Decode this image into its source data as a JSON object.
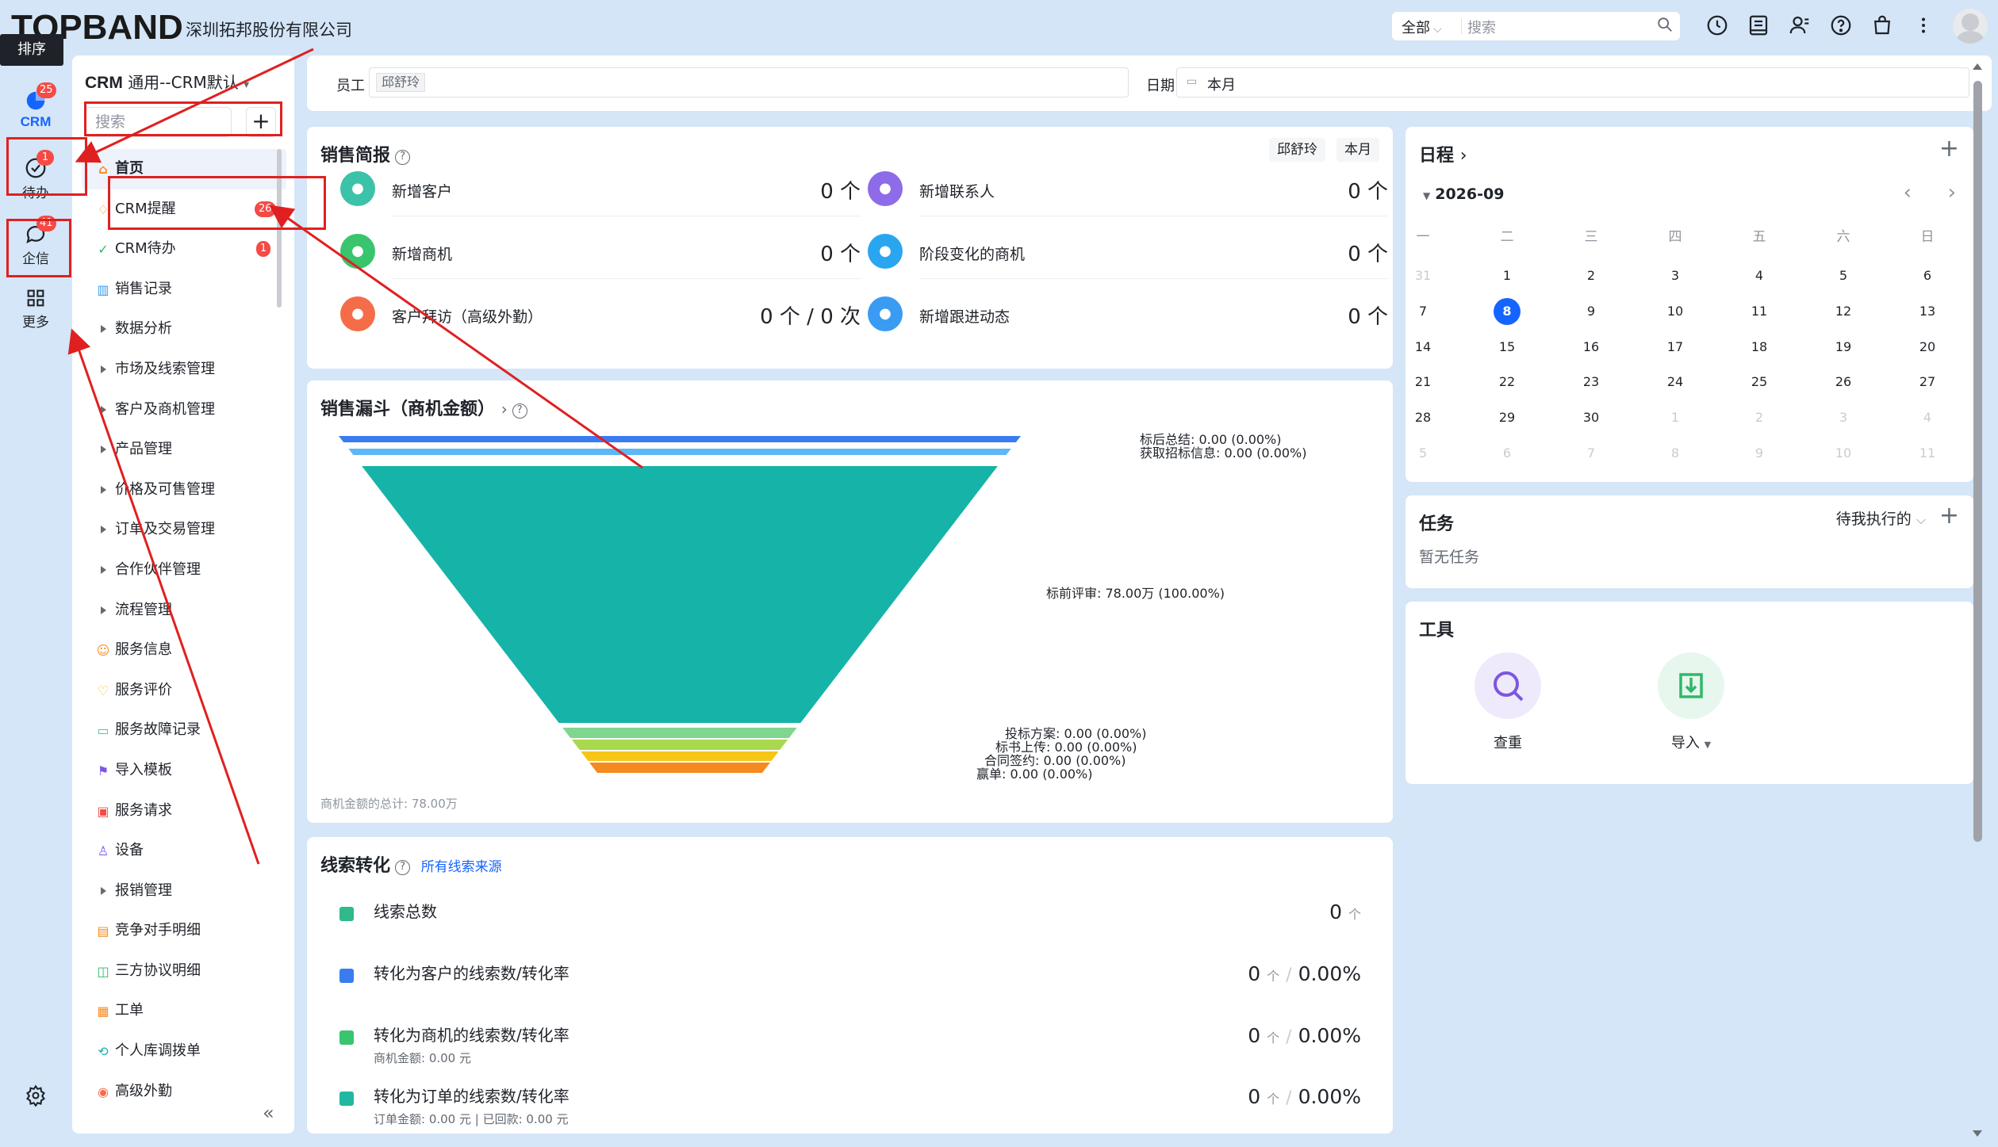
{
  "header": {
    "logo": "TOPBAND",
    "company": "深圳拓邦股份有限公司",
    "tooltip": "排序",
    "search_scope": "全部",
    "search_placeholder": "搜索",
    "icons": [
      "clock-icon",
      "contacts-book-icon",
      "user-group-icon",
      "help-icon",
      "bag-icon",
      "more-vertical-icon"
    ]
  },
  "rail": {
    "items": [
      {
        "label": "CRM",
        "badge": "25"
      },
      {
        "label": "待办",
        "badge": "1"
      },
      {
        "label": "企信",
        "badge": "41"
      },
      {
        "label": "更多",
        "badge": ""
      }
    ]
  },
  "nav": {
    "title": "CRM",
    "subtitle": "通用--CRM默认",
    "search_placeholder": "搜索",
    "plus": "+",
    "collapse": "«",
    "items": [
      {
        "label": "首页",
        "icon": "home-icon",
        "badge": ""
      },
      {
        "label": "CRM提醒",
        "icon": "bell-icon",
        "badge": "26"
      },
      {
        "label": "CRM待办",
        "icon": "check-circle-icon",
        "badge": "1"
      },
      {
        "label": "销售记录",
        "icon": "bar-chart-icon",
        "badge": ""
      },
      {
        "label": "数据分析",
        "icon": "caret-icon",
        "badge": ""
      },
      {
        "label": "市场及线索管理",
        "icon": "caret-icon",
        "badge": ""
      },
      {
        "label": "客户及商机管理",
        "icon": "caret-icon",
        "badge": ""
      },
      {
        "label": "产品管理",
        "icon": "caret-icon",
        "badge": ""
      },
      {
        "label": "价格及可售管理",
        "icon": "caret-icon",
        "badge": ""
      },
      {
        "label": "订单及交易管理",
        "icon": "caret-icon",
        "badge": ""
      },
      {
        "label": "合作伙伴管理",
        "icon": "caret-icon",
        "badge": ""
      },
      {
        "label": "流程管理",
        "icon": "caret-icon",
        "badge": ""
      },
      {
        "label": "服务信息",
        "icon": "service-user-icon",
        "badge": ""
      },
      {
        "label": "服务评价",
        "icon": "heart-icon",
        "badge": ""
      },
      {
        "label": "服务故障记录",
        "icon": "clipboard-icon",
        "badge": ""
      },
      {
        "label": "导入模板",
        "icon": "flag-icon",
        "badge": ""
      },
      {
        "label": "服务请求",
        "icon": "request-icon",
        "badge": ""
      },
      {
        "label": "设备",
        "icon": "tie-icon",
        "badge": ""
      },
      {
        "label": "报销管理",
        "icon": "caret-icon",
        "badge": ""
      },
      {
        "label": "竞争对手明细",
        "icon": "doc-icon",
        "badge": ""
      },
      {
        "label": "三方协议明细",
        "icon": "bookmark-icon",
        "badge": ""
      },
      {
        "label": "工单",
        "icon": "ticket-icon",
        "badge": ""
      },
      {
        "label": "个人库调拨单",
        "icon": "transfer-icon",
        "badge": ""
      },
      {
        "label": "高级外勤",
        "icon": "location-icon",
        "badge": ""
      }
    ]
  },
  "filter": {
    "employee_label": "员工",
    "employee_value": "邱舒玲",
    "date_label": "日期",
    "date_value": "本月"
  },
  "brief": {
    "title": "销售简报",
    "chip_user": "邱舒玲",
    "chip_period": "本月",
    "metrics": [
      {
        "label": "新增客户",
        "value": "0 个",
        "color": "#3cc2a8",
        "icon": "customer-icon"
      },
      {
        "label": "新增联系人",
        "value": "0 个",
        "color": "#8e6be8",
        "icon": "contact-icon"
      },
      {
        "label": "新增商机",
        "value": "0 个",
        "color": "#39c46e",
        "icon": "opportunity-icon"
      },
      {
        "label": "阶段变化的商机",
        "value": "0 个",
        "color": "#2aa6f0",
        "icon": "stage-icon"
      },
      {
        "label": "客户拜访（高级外勤）",
        "value": "0 个 / 0 次",
        "color": "#f56c48",
        "icon": "visit-icon"
      },
      {
        "label": "新增跟进动态",
        "value": "0 个",
        "color": "#3a9bf2",
        "icon": "followup-icon"
      }
    ]
  },
  "funnel": {
    "title": "销售漏斗（商机金额）",
    "footnote": "商机金额的总计: 78.00万"
  },
  "chart_data": {
    "type": "funnel",
    "title": "销售漏斗（商机金额）",
    "total": "78.00万",
    "stages": [
      {
        "name": "标后总结",
        "amount": 0.0,
        "percent": "0.00%",
        "label": "标后总结: 0.00 (0.00%)",
        "color": "#3a7cf0"
      },
      {
        "name": "获取招标信息",
        "amount": 0.0,
        "percent": "0.00%",
        "label": "获取招标信息: 0.00 (0.00%)",
        "color": "#5cb8f5"
      },
      {
        "name": "标前评审",
        "amount": 78.0,
        "unit": "万",
        "percent": "100.00%",
        "label": "标前评审: 78.00万 (100.00%)",
        "color": "#16b3a8"
      },
      {
        "name": "投标方案",
        "amount": 0.0,
        "percent": "0.00%",
        "label": "投标方案: 0.00 (0.00%)",
        "color": "#7fd68f"
      },
      {
        "name": "标书上传",
        "amount": 0.0,
        "percent": "0.00%",
        "label": "标书上传: 0.00 (0.00%)",
        "color": "#a8d94f"
      },
      {
        "name": "合同签约",
        "amount": 0.0,
        "percent": "0.00%",
        "label": "合同签约: 0.00 (0.00%)",
        "color": "#f5c518"
      },
      {
        "name": "赢单",
        "amount": 0.0,
        "percent": "0.00%",
        "label": "赢单: 0.00 (0.00%)",
        "color": "#f58a1f"
      }
    ]
  },
  "leads": {
    "title": "线索转化",
    "source_link": "所有线索来源",
    "rows": [
      {
        "label": "线索总数",
        "sub": "",
        "count": "0",
        "unit": "个",
        "rate": "",
        "color": "#2fb98c"
      },
      {
        "label": "转化为客户的线索数/转化率",
        "sub": "",
        "count": "0",
        "unit": "个",
        "rate": "0.00%",
        "color": "#3a7cf0"
      },
      {
        "label": "转化为商机的线索数/转化率",
        "sub": "商机金额: 0.00 元",
        "count": "0",
        "unit": "个",
        "rate": "0.00%",
        "color": "#39c46e"
      },
      {
        "label": "转化为订单的线索数/转化率",
        "sub": "订单金额: 0.00 元 | 已回款: 0.00 元",
        "count": "0",
        "unit": "个",
        "rate": "0.00%",
        "color": "#22b8a0"
      }
    ]
  },
  "schedule": {
    "title": "日程",
    "month": "2026-09",
    "weekdays": [
      "一",
      "二",
      "三",
      "四",
      "五",
      "六",
      "日"
    ],
    "weeks": [
      [
        {
          "d": "31",
          "m": true
        },
        {
          "d": "1"
        },
        {
          "d": "2"
        },
        {
          "d": "3"
        },
        {
          "d": "4"
        },
        {
          "d": "5"
        },
        {
          "d": "6"
        }
      ],
      [
        {
          "d": "7"
        },
        {
          "d": "8",
          "today": true
        },
        {
          "d": "9"
        },
        {
          "d": "10"
        },
        {
          "d": "11"
        },
        {
          "d": "12"
        },
        {
          "d": "13"
        }
      ],
      [
        {
          "d": "14"
        },
        {
          "d": "15"
        },
        {
          "d": "16"
        },
        {
          "d": "17"
        },
        {
          "d": "18"
        },
        {
          "d": "19"
        },
        {
          "d": "20"
        }
      ],
      [
        {
          "d": "21"
        },
        {
          "d": "22"
        },
        {
          "d": "23"
        },
        {
          "d": "24"
        },
        {
          "d": "25"
        },
        {
          "d": "26"
        },
        {
          "d": "27"
        }
      ],
      [
        {
          "d": "28"
        },
        {
          "d": "29"
        },
        {
          "d": "30"
        },
        {
          "d": "1",
          "m": true
        },
        {
          "d": "2",
          "m": true
        },
        {
          "d": "3",
          "m": true
        },
        {
          "d": "4",
          "m": true
        }
      ],
      [
        {
          "d": "5",
          "m": true
        },
        {
          "d": "6",
          "m": true
        },
        {
          "d": "7",
          "m": true
        },
        {
          "d": "8",
          "m": true
        },
        {
          "d": "9",
          "m": true
        },
        {
          "d": "10",
          "m": true
        },
        {
          "d": "11",
          "m": true
        }
      ]
    ]
  },
  "tasks": {
    "title": "任务",
    "filter": "待我执行的",
    "empty": "暂无任务"
  },
  "tools": {
    "title": "工具",
    "items": [
      {
        "label": "查重",
        "icon": "search-icon"
      },
      {
        "label": "导入",
        "icon": "import-icon"
      }
    ]
  },
  "colors": {
    "accent": "#1664ff",
    "badge": "#f54a45",
    "annotation": "#e02020"
  }
}
